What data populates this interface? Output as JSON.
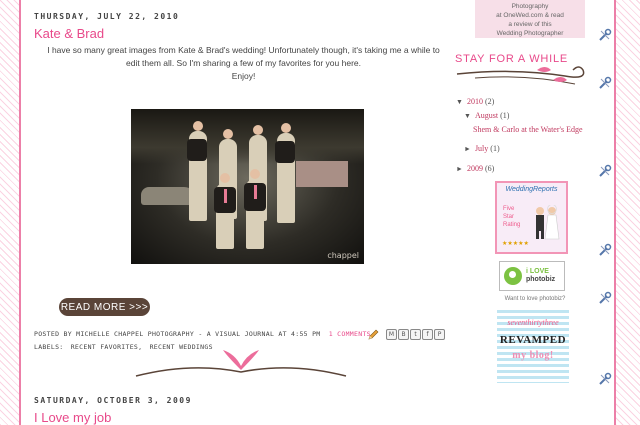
{
  "post1": {
    "date": "THURSDAY, JULY 22, 2010",
    "title": "Kate & Brad",
    "body_line1": "I have so many great images from Kate & Brad's wedding! Unfortunately though, it's taking me a while to",
    "body_line2": "edit them all. So I'm sharing a few of my favorites for you here.",
    "body_line3": "Enjoy!",
    "photo_watermark": "chappel",
    "read_more": "READ MORE >>>",
    "posted_by_prefix": "POSTED BY MICHELLE CHAPPEL PHOTOGRAPHY - A VISUAL JOURNAL AT 4:55 PM",
    "comments": "1 COMMENTS",
    "labels_prefix": "LABELS:",
    "label1": "RECENT FAVORITES",
    "label_sep": ",",
    "label2": "RECENT WEDDINGS",
    "share_buttons": [
      "M",
      "B",
      "t",
      "f",
      "P"
    ]
  },
  "post2": {
    "date": "SATURDAY, OCTOBER 3, 2009",
    "title": "I Love my job"
  },
  "sidebar": {
    "top_text_line1": "Photography",
    "top_text_line2": "at OneWed.com & read",
    "top_text_line3": "a review of this",
    "top_text_line4": "Wedding Photographer",
    "heading": "STAY FOR A WHILE",
    "archive": {
      "y2010": {
        "tri": "▼",
        "label": "2010",
        "count": "(2)"
      },
      "aug": {
        "tri": "▼",
        "label": "August",
        "count": "(1)"
      },
      "aug_post": "Shem & Carlo at the Water's Edge",
      "jul": {
        "tri": "►",
        "label": "July",
        "count": "(1)"
      },
      "y2009": {
        "tri": "►",
        "label": "2009",
        "count": "(6)"
      }
    },
    "wedding_reports": {
      "title": "WeddingReports",
      "line1": "Five",
      "line2": "Star",
      "line3": "Rating",
      "stars": "★★★★★"
    },
    "photobiz": {
      "line1": "i LOVE",
      "line2": "photobiz",
      "caption": "Want to love photobiz?"
    },
    "blog_badge": {
      "line1": "seventhirtythree",
      "line2": "REVAMPED",
      "line3": "my blog!"
    }
  },
  "colors": {
    "accent_pink": "#e8498a",
    "border_pink": "#ec7fa8",
    "button_brown": "#5a4438"
  }
}
